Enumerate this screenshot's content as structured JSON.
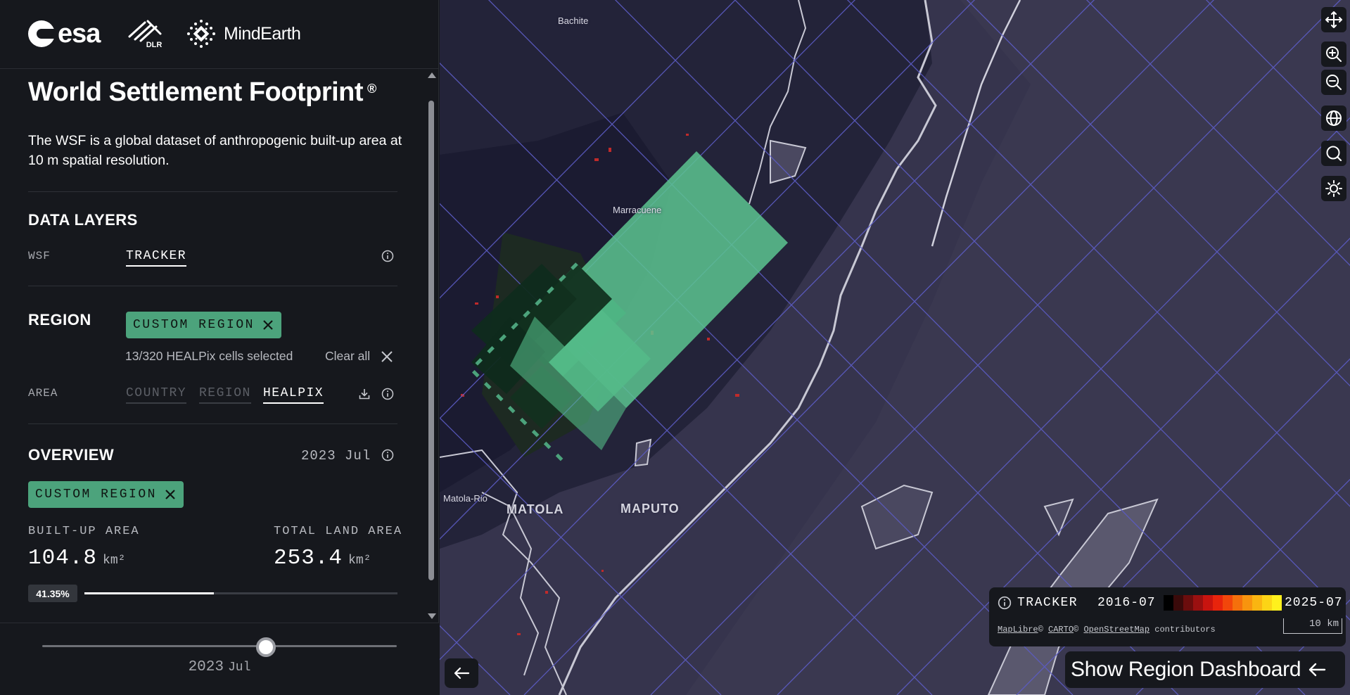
{
  "header": {
    "logo_esa": "esa",
    "logo_dlr": "DLR",
    "logo_mindearth": "MindEarth"
  },
  "page": {
    "title": "World Settlement Footprint",
    "title_mark": "®",
    "description": "The WSF is a global dataset of anthropogenic built-up area at 10 m spatial resolution."
  },
  "data_layers": {
    "title": "DATA LAYERS",
    "label": "WSF",
    "tab": "TRACKER"
  },
  "region": {
    "title": "REGION",
    "chip": "CUSTOM REGION",
    "cells_selected": "13/320 HEALPix cells selected",
    "clear_all": "Clear all",
    "area_label": "AREA",
    "area_tabs": [
      "COUNTRY",
      "REGION",
      "HEALPIX"
    ],
    "active_area_tab": "HEALPIX"
  },
  "overview": {
    "title": "OVERVIEW",
    "year": "2023",
    "month": "Jul",
    "chip": "CUSTOM REGION",
    "built_up_label": "BUILT-UP AREA",
    "built_up_value": "104.8",
    "built_up_unit": "km²",
    "total_land_label": "TOTAL LAND AREA",
    "total_land_value": "253.4",
    "total_land_unit": "km²",
    "percent_label": "41.35%",
    "percent": 41.35
  },
  "timeline": {
    "year": "2023",
    "month": "Jul",
    "position": 0.63
  },
  "map": {
    "labels": [
      "Bachite",
      "Marracuene",
      "Matola-Rio",
      "MATOLA",
      "MAPUTO"
    ],
    "controls": [
      "move-icon",
      "zoom-in-icon",
      "zoom-out-icon",
      "globe-icon",
      "search-icon",
      "sun-icon"
    ]
  },
  "legend": {
    "title": "TRACKER",
    "start": "2016-07",
    "end": "2025-07",
    "ramp_colors": [
      "#000000",
      "#3a0a0a",
      "#6b0d0d",
      "#9a1010",
      "#c8140f",
      "#e8240c",
      "#f2460b",
      "#f5700c",
      "#f8940e",
      "#fab511",
      "#fcd416",
      "#fff01d"
    ],
    "attribution_maplibre": "MapLibre",
    "attribution_carto": "CARTO",
    "attribution_osm": "OpenStreetMap",
    "attribution_suffix": "contributors",
    "copyright": "©",
    "scale": "10 km"
  },
  "actions": {
    "show_dashboard": "Show Region Dashboard"
  },
  "colors": {
    "accent_green": "#4ca37c",
    "map_bg": "#36344d",
    "panel_bg": "#16181d"
  }
}
